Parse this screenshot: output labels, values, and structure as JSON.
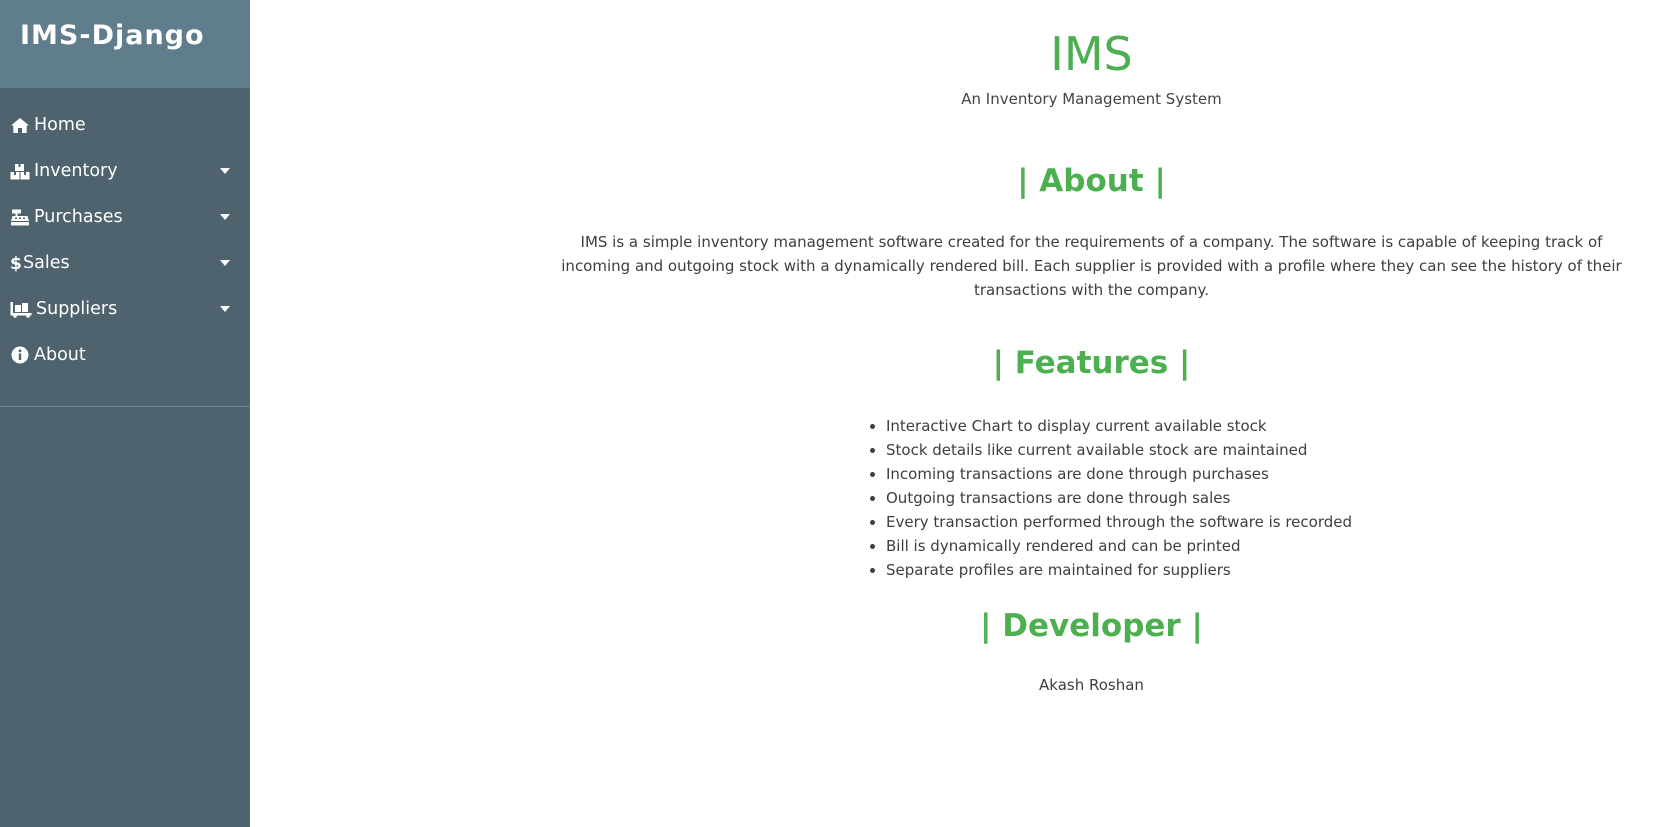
{
  "sidebar": {
    "brand": "IMS-Django",
    "items": [
      {
        "label": "Home",
        "icon": "home-icon",
        "has_dropdown": false
      },
      {
        "label": "Inventory",
        "icon": "cubes-icon",
        "has_dropdown": true
      },
      {
        "label": "Purchases",
        "icon": "cash-register-icon",
        "has_dropdown": true
      },
      {
        "label": "Sales",
        "icon": "dollar-icon",
        "has_dropdown": true
      },
      {
        "label": "Suppliers",
        "icon": "truck-loading-icon",
        "has_dropdown": true
      },
      {
        "label": "About",
        "icon": "info-circle-icon",
        "has_dropdown": false
      }
    ]
  },
  "main": {
    "title": "IMS",
    "subtitle": "An Inventory Management System",
    "about": {
      "heading": "| About |",
      "text": "IMS is a simple inventory management software created for the requirements of a company. The software is capable of keeping track of incoming and outgoing stock with a dynamically rendered bill. Each supplier is provided with a profile where they can see the history of their transactions with the company."
    },
    "features": {
      "heading": "| Features |",
      "items": [
        "Interactive Chart to display current available stock",
        "Stock details like current available stock are maintained",
        "Incoming transactions are done through purchases",
        "Outgoing transactions are done through sales",
        "Every transaction performed through the software is recorded",
        "Bill is dynamically rendered and can be printed",
        "Separate profiles are maintained for suppliers"
      ]
    },
    "developer": {
      "heading": "| Developer |",
      "name": "Akash Roshan"
    }
  },
  "colors": {
    "sidebar_bg": "#4e636d",
    "brand_bg": "#5f7d8c",
    "accent_green": "#4caf50",
    "text": "#3e3e3e"
  }
}
